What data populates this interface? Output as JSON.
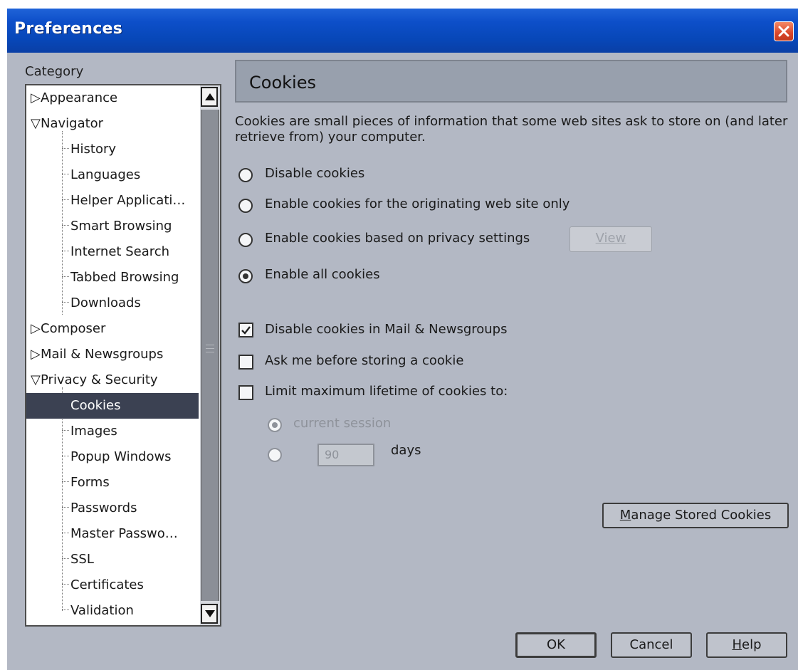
{
  "window": {
    "title": "Preferences"
  },
  "sidebar": {
    "label": "Category",
    "items": [
      {
        "label": "Appearance",
        "expander": "▷"
      },
      {
        "label": "Navigator",
        "expander": "▽"
      },
      {
        "label": "History"
      },
      {
        "label": "Languages"
      },
      {
        "label": "Helper Applicati…"
      },
      {
        "label": "Smart Browsing"
      },
      {
        "label": "Internet Search"
      },
      {
        "label": "Tabbed Browsing"
      },
      {
        "label": "Downloads"
      },
      {
        "label": "Composer",
        "expander": "▷"
      },
      {
        "label": "Mail & Newsgroups",
        "expander": "▷"
      },
      {
        "label": "Privacy & Security",
        "expander": "▽"
      },
      {
        "label": "Cookies",
        "selected": true
      },
      {
        "label": "Images"
      },
      {
        "label": "Popup Windows"
      },
      {
        "label": "Forms"
      },
      {
        "label": "Passwords"
      },
      {
        "label": "Master Passwo…"
      },
      {
        "label": "SSL"
      },
      {
        "label": "Certificates"
      },
      {
        "label": "Validation"
      }
    ]
  },
  "panel": {
    "title": "Cookies",
    "intro": "Cookies are small pieces of information that some web sites ask to store on (and later retrieve from) your computer.",
    "radios": {
      "disable": "Disable cookies",
      "originating": "Enable cookies for the originating web site only",
      "privacy": "Enable cookies based on privacy settings",
      "all": "Enable all cookies",
      "selected": "all"
    },
    "view_button": "View",
    "checkboxes": {
      "mail": {
        "label": "Disable cookies in Mail & Newsgroups",
        "checked": true
      },
      "ask": {
        "label": "Ask me before storing a cookie",
        "checked": false
      },
      "limit": {
        "label": "Limit maximum lifetime of cookies to:",
        "checked": false
      }
    },
    "lifetime": {
      "session_label": "current session",
      "days_value": "90",
      "days_label": "days",
      "selected": "session"
    },
    "manage_button_prefix": "M",
    "manage_button_rest": "anage Stored Cookies"
  },
  "footer": {
    "ok": "OK",
    "cancel": "Cancel",
    "help_prefix": "H",
    "help_rest": "elp"
  },
  "colors": {
    "titlebar": "#0747b8",
    "window_bg": "#b3b8c4",
    "selection": "#3b4152",
    "close_button": "#d9462a"
  }
}
